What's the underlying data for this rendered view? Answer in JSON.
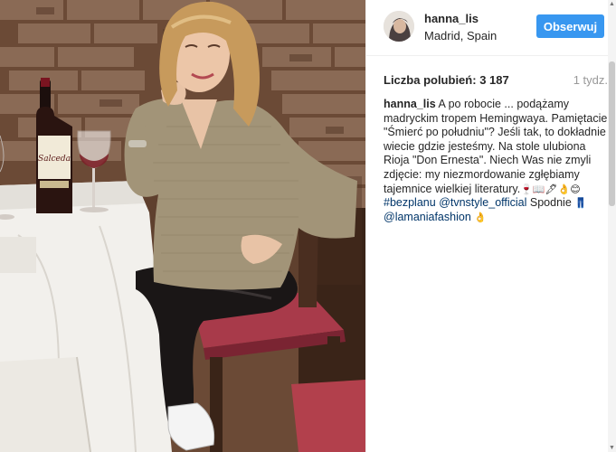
{
  "post": {
    "photo": {
      "description_icon": "photo-image"
    },
    "header": {
      "username": "hanna_lis",
      "location": "Madrid, Spain",
      "follow_label": "Obserwuj"
    },
    "likes": {
      "label": "Liczba polubień:",
      "count": "3 187"
    },
    "time": "1 tydz.",
    "caption": {
      "author": "hanna_lis",
      "text_part1": " A po robocie ... podążamy madryckim tropem Hemingwaya. Pamiętacie \"Śmierć po południu\"? Jeśli tak, to dokładnie wiecie gdzie jesteśmy. Na stole ulubiona Rioja \"Don Ernesta\". Niech Was nie zmyli zdjęcie: my niezmordowanie zgłębiamy tajemnice wielkiej literatury.",
      "emojis_1": "🍷📖🖋👌😊",
      "hashtag": "#bezplanu",
      "mention_1": "@tvnstyle_official",
      "text_part2": " Spodnie ",
      "emoji_pants": "👖",
      "mention_2": "@lamaniafashion",
      "emoji_hand": "👌"
    }
  },
  "colors": {
    "follow_button": "#3897f0",
    "link": "#003569",
    "muted": "#999999"
  }
}
